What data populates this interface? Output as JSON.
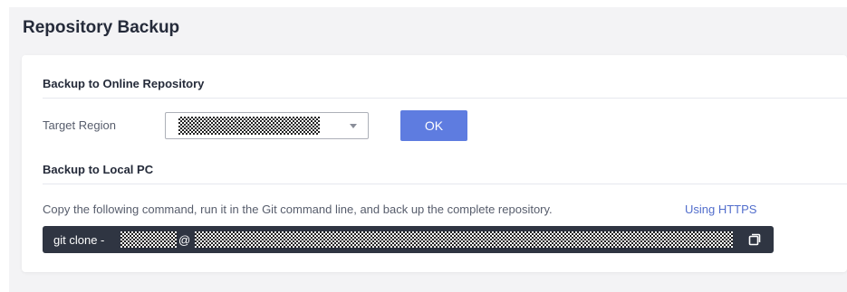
{
  "page": {
    "title": "Repository Backup"
  },
  "online": {
    "section_title": "Backup to Online Repository",
    "target_region_label": "Target Region",
    "ok_label": "OK"
  },
  "local": {
    "section_title": "Backup to Local PC",
    "description": "Copy the following command, run it in the Git command line, and back up the complete repository.",
    "protocol_link": "Using HTTPS",
    "command_prefix": "git clone -",
    "command_at": "@"
  },
  "colors": {
    "accent": "#5e7ce0",
    "link": "#526ecc",
    "command_bg": "#2f3542"
  },
  "icons": {
    "copy": "copy-icon",
    "dropdown": "chevron-down-icon"
  }
}
